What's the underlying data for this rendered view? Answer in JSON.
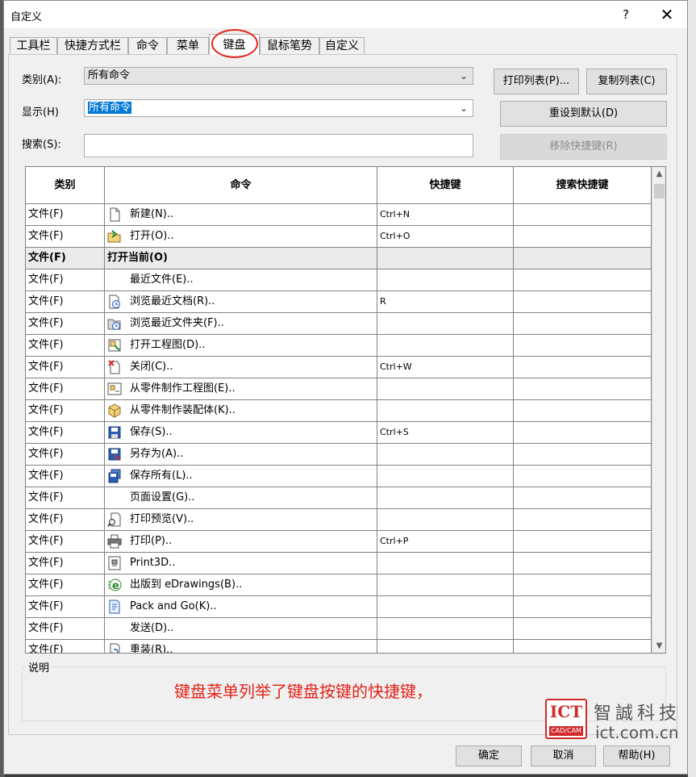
{
  "window": {
    "title": "自定义",
    "help_glyph": "?",
    "close_glyph": "✕"
  },
  "tabs": [
    {
      "label": "工具栏"
    },
    {
      "label": "快捷方式栏"
    },
    {
      "label": "命令"
    },
    {
      "label": "菜单"
    },
    {
      "label": "键盘",
      "active": true
    },
    {
      "label": "鼠标笔势"
    },
    {
      "label": "自定义"
    }
  ],
  "form": {
    "category_label": "类别(A):",
    "category_value": "所有命令",
    "display_label": "显示(H)",
    "display_value": "所有命令",
    "search_label": "搜索(S):",
    "search_value": ""
  },
  "buttons": {
    "print_list": "打印列表(P)...",
    "copy_list": "复制列表(C)",
    "reset_default": "重设到默认(D)",
    "remove_shortcut": "移除快捷键(R)",
    "ok": "确定",
    "cancel": "取消",
    "help": "帮助(H)"
  },
  "grid": {
    "columns": [
      "类别",
      "命令",
      "快捷键",
      "搜索快捷键"
    ],
    "rows": [
      {
        "category": "文件(F)",
        "command": "新建(N)..",
        "shortcut": "Ctrl+N",
        "search": "",
        "icon": "new-document-icon"
      },
      {
        "category": "文件(F)",
        "command": "打开(O)..",
        "shortcut": "Ctrl+O",
        "search": "",
        "icon": "open-folder-icon"
      },
      {
        "category": "文件(F)",
        "command": "打开当前(O)",
        "shortcut": "",
        "search": "",
        "icon": "",
        "bold": true
      },
      {
        "category": "文件(F)",
        "command": "最近文件(E)..",
        "shortcut": "",
        "search": "",
        "icon": ""
      },
      {
        "category": "文件(F)",
        "command": "浏览最近文档(R)..",
        "shortcut": "R",
        "search": "",
        "icon": "recent-document-icon"
      },
      {
        "category": "文件(F)",
        "command": "浏览最近文件夹(F)..",
        "shortcut": "",
        "search": "",
        "icon": "recent-folder-icon"
      },
      {
        "category": "文件(F)",
        "command": "打开工程图(D)..",
        "shortcut": "",
        "search": "",
        "icon": "open-drawing-icon"
      },
      {
        "category": "文件(F)",
        "command": "关闭(C)..",
        "shortcut": "Ctrl+W",
        "search": "",
        "icon": "close-document-icon"
      },
      {
        "category": "文件(F)",
        "command": "从零件制作工程图(E)..",
        "shortcut": "",
        "search": "",
        "icon": "make-drawing-icon"
      },
      {
        "category": "文件(F)",
        "command": "从零件制作装配体(K)..",
        "shortcut": "",
        "search": "",
        "icon": "make-assembly-icon"
      },
      {
        "category": "文件(F)",
        "command": "保存(S)..",
        "shortcut": "Ctrl+S",
        "search": "",
        "icon": "save-icon"
      },
      {
        "category": "文件(F)",
        "command": "另存为(A)..",
        "shortcut": "",
        "search": "",
        "icon": "save-as-icon"
      },
      {
        "category": "文件(F)",
        "command": "保存所有(L)..",
        "shortcut": "",
        "search": "",
        "icon": "save-all-icon"
      },
      {
        "category": "文件(F)",
        "command": "页面设置(G)..",
        "shortcut": "",
        "search": "",
        "icon": ""
      },
      {
        "category": "文件(F)",
        "command": "打印预览(V)..",
        "shortcut": "",
        "search": "",
        "icon": "print-preview-icon"
      },
      {
        "category": "文件(F)",
        "command": "打印(P)..",
        "shortcut": "Ctrl+P",
        "search": "",
        "icon": "print-icon"
      },
      {
        "category": "文件(F)",
        "command": "Print3D..",
        "shortcut": "",
        "search": "",
        "icon": "print3d-icon"
      },
      {
        "category": "文件(F)",
        "command": "出版到 eDrawings(B)..",
        "shortcut": "",
        "search": "",
        "icon": "edrawings-icon"
      },
      {
        "category": "文件(F)",
        "command": "Pack and Go(K)..",
        "shortcut": "",
        "search": "",
        "icon": "pack-and-go-icon"
      },
      {
        "category": "文件(F)",
        "command": "发送(D)..",
        "shortcut": "",
        "search": "",
        "icon": ""
      },
      {
        "category": "文件(F)",
        "command": "重装(R)..",
        "shortcut": "",
        "search": "",
        "icon": "reload-icon"
      }
    ]
  },
  "description": {
    "label": "说明",
    "annotation": "键盘菜单列举了键盘按键的快捷键，"
  },
  "logo": {
    "mark": "ICT",
    "sub": "CAD/CAM",
    "cn": "智誠科技",
    "url": "ict.com.cn"
  },
  "colors": {
    "accent_red": "#e2231a",
    "selection_blue": "#0078d7"
  }
}
